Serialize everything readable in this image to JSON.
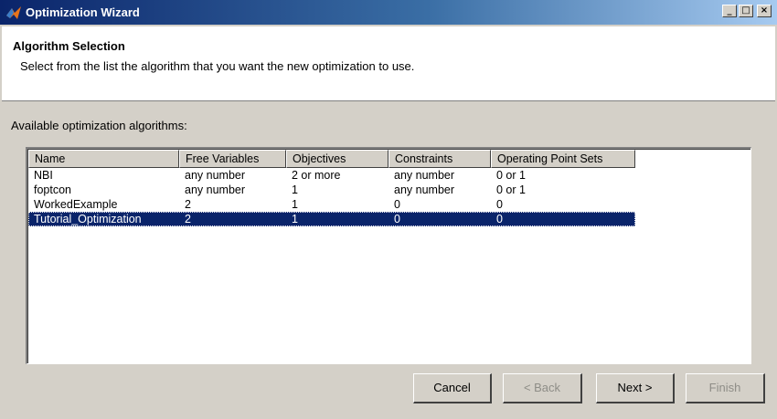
{
  "window": {
    "title": "Optimization Wizard"
  },
  "title_buttons": {
    "minimize": "_",
    "maximize": "□",
    "close": "×"
  },
  "header": {
    "title": "Algorithm Selection",
    "description": "Select from the list the algorithm that you want the new optimization to use."
  },
  "list": {
    "label": "Available optimization algorithms:",
    "columns": [
      "Name",
      "Free Variables",
      "Objectives",
      "Constraints",
      "Operating Point Sets"
    ],
    "rows": [
      [
        "NBI",
        "any number",
        "2 or more",
        "any number",
        "0 or 1"
      ],
      [
        "foptcon",
        "any number",
        "1",
        "any number",
        "0 or 1"
      ],
      [
        "WorkedExample",
        "2",
        "1",
        "0",
        "0"
      ],
      [
        "Tutorial_Optimization",
        "2",
        "1",
        "0",
        "0"
      ]
    ],
    "selected_index": 3
  },
  "buttons": {
    "cancel": "Cancel",
    "back": "< Back",
    "next": "Next >",
    "finish": "Finish"
  },
  "colors": {
    "selection": "#0a246a",
    "titlebar": "#0a246a",
    "face": "#d4d0c8"
  }
}
